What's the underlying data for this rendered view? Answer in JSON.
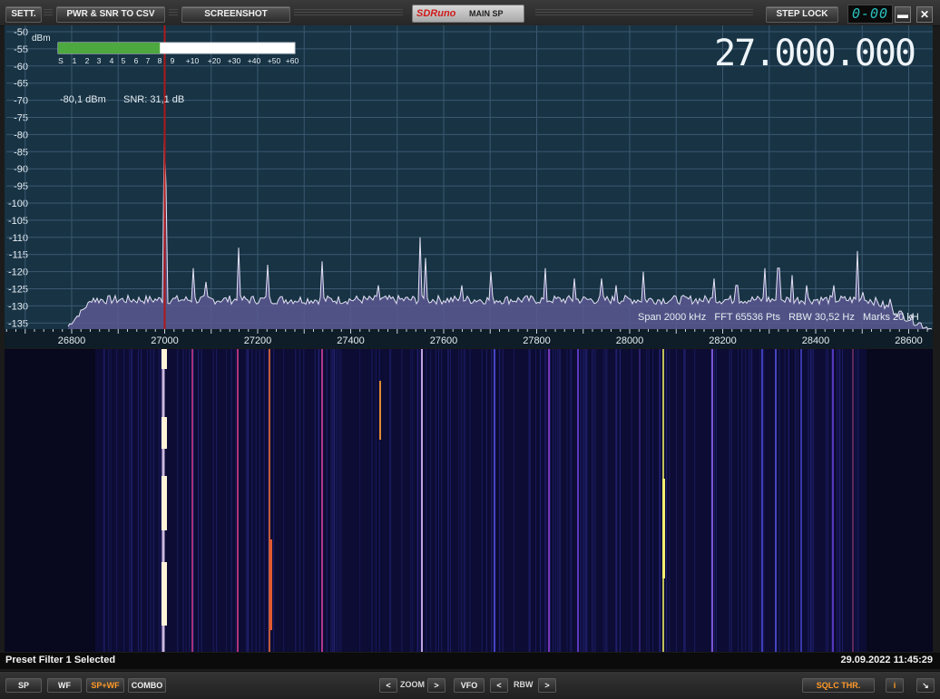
{
  "toolbar": {
    "sett": "SETT.",
    "pwr_snr_csv": "PWR & SNR TO CSV",
    "screenshot": "SCREENSHOT",
    "app_logo": "SDRuno",
    "main_sp": "MAIN SP",
    "step_lock": "STEP LOCK",
    "segment_display": "0-00",
    "minimize": "▬",
    "close": "✕"
  },
  "spectrum": {
    "frequency": "27.000.000",
    "unit": "dBm",
    "power": "-80,1 dBm",
    "snr": "SNR: 31,1 dB",
    "info": "Span 2000 kHz   FFT 65536 Pts   RBW 30,52 Hz   Marks 20 kH",
    "y_ticks": [
      "-50",
      "-55",
      "-60",
      "-65",
      "-70",
      "-75",
      "-80",
      "-85",
      "-90",
      "-95",
      "-100",
      "-105",
      "-110",
      "-115",
      "-120",
      "-125",
      "-130",
      "-135"
    ],
    "x_ticks": [
      "26800",
      "27000",
      "27200",
      "27400",
      "27600",
      "27800",
      "28000",
      "28200",
      "28400",
      "28600"
    ],
    "s_meter_labels": [
      "S",
      "1",
      "2",
      "3",
      "4",
      "5",
      "6",
      "7",
      "8",
      "9",
      "+10",
      "+20",
      "+30",
      "+40",
      "+50",
      "+60"
    ],
    "s_meter_level": 0.43,
    "colors": {
      "background": "#173344",
      "trace_fill": "#5a5890",
      "marker": "#b01818",
      "meter": "#4ea840"
    }
  },
  "status": {
    "message": "Preset Filter 1 Selected",
    "datetime": "29.09.2022 11:45:29"
  },
  "bottombar": {
    "sp": "SP",
    "wf": "WF",
    "sp_wf": "SP+WF",
    "combo": "COMBO",
    "zoom": "ZOOM",
    "vfo": "VFO",
    "rbw": "RBW",
    "sqlc": "SQLC THR.",
    "info_btn": "i",
    "prev": "<",
    "next": ">",
    "resize": "↘"
  }
}
